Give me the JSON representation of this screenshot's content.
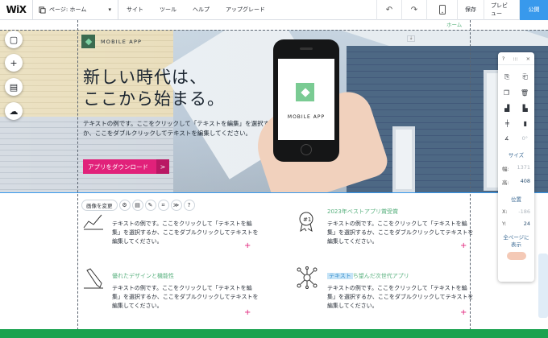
{
  "topbar": {
    "logo": "WiX",
    "page_selector": "ページ: ホーム",
    "menu": [
      "サイト",
      "ツール",
      "ヘルプ",
      "アップグレード"
    ],
    "undo_icon": "undo-icon",
    "redo_icon": "redo-icon",
    "mobile_icon": "mobile-icon",
    "save": "保存",
    "preview": "プレビュー",
    "publish": "公開"
  },
  "hero": {
    "brand": "MOBILE APP",
    "headline_line1": "新しい時代は、",
    "headline_line2": "ここから始まる。",
    "description": "テキストの例です。ここをクリックして「テキストを編集」を選択するか、ここをダブルクリックしてテキストを編集してください。",
    "cta": "アプリをダウンロード",
    "cta_arrow": ">",
    "phone_label": "MOBILE APP"
  },
  "section_label": "ホーム",
  "element_toolbar": {
    "change_image": "画像を変更",
    "icons": [
      "settings-icon",
      "layout-icon",
      "edit-icon",
      "crop-icon",
      "animation-icon",
      "help-icon"
    ]
  },
  "features": [
    {
      "title": "",
      "text": "テキストの例です。ここをクリックして「テキストを編集」を選択するか、ここをダブルクリックしてテキストを編集してください。",
      "icon": "chart-icon"
    },
    {
      "title": "2023年ベストアプリ賞受賞",
      "text": "テキストの例です。ここをクリックして「テキストを編集」を選択するか、ここをダブルクリックしてテキストを編集してください。",
      "icon": "medal-icon"
    },
    {
      "title": "優れたデザインと機能性",
      "text": "テキストの例です。ここをクリックして「テキストを編集」を選択するか、ここをダブルクリックしてテキストを編集してください。",
      "icon": "pencil-icon"
    },
    {
      "title_highlight": "テキスト",
      "title_rest": "ち望んだ次世代アプリ",
      "text": "テキストの例です。ここをクリックして「テキストを編集」を選択するか、ここをダブルクリックしてテキストを編集してください。",
      "icon": "network-icon"
    }
  ],
  "plus": "+",
  "panel": {
    "help": "?",
    "dots": ":::",
    "close": "×",
    "size_label": "サイズ",
    "width_label": "幅:",
    "width_value": "1371",
    "height_label": "高:",
    "height_value": "408",
    "position_label": "位置",
    "x_label": "X:",
    "x_value": "-186",
    "y_label": "Y:",
    "y_value": "24",
    "all_pages": "全ページに表示",
    "angle_value": "0°"
  },
  "rail_icons": [
    "add-section-icon",
    "add-icon",
    "media-icon",
    "upload-icon"
  ],
  "colors": {
    "accent": "#3899ec",
    "cta": "#e1217a",
    "green": "#58b07e"
  }
}
